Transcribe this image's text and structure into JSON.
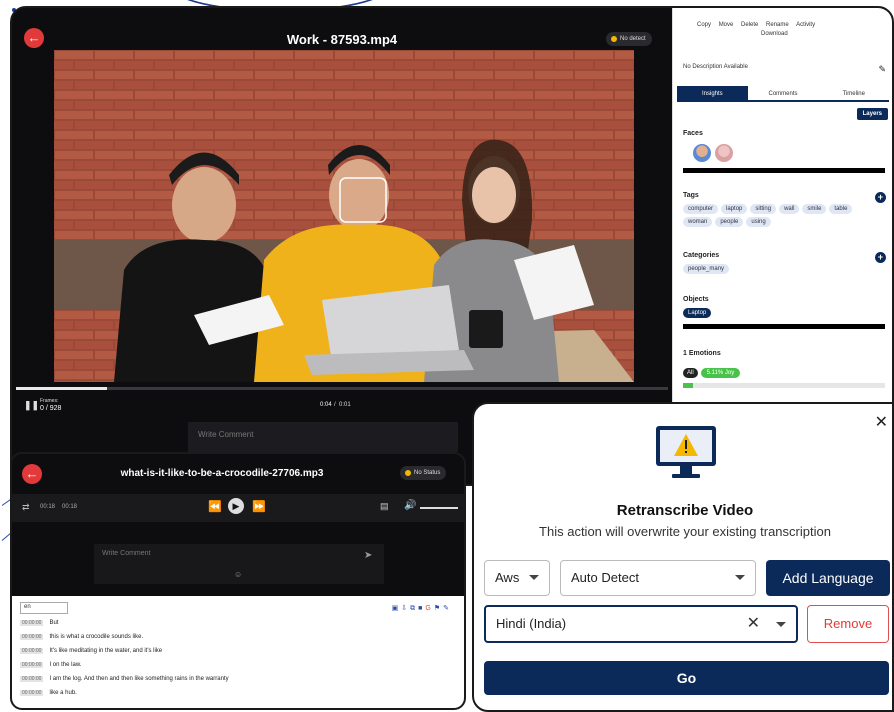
{
  "main_player": {
    "title": "Work - 87593.mp4",
    "status": "No detect",
    "frames_label": "Frames:",
    "frames_value": "0 / 928",
    "time_current": "0:04",
    "time_total": "0:01",
    "comment_placeholder": "Write Comment",
    "progress_fraction": 0.14
  },
  "side_panel": {
    "toolbar": [
      "Copy",
      "Move",
      "Delete",
      "Rename",
      "Activity",
      "Download"
    ],
    "description": "No Description Available",
    "tabs": [
      "Insights",
      "Comments",
      "Timeline"
    ],
    "active_tab": "Insights",
    "layers_label": "Layers",
    "faces_title": "Faces",
    "tags_title": "Tags",
    "tags": [
      "computer",
      "laptop",
      "sitting",
      "wall",
      "smile",
      "table",
      "woman",
      "people",
      "using"
    ],
    "categories_title": "Categories",
    "categories": [
      "people_many"
    ],
    "objects_title": "Objects",
    "objects": [
      "Laptop"
    ],
    "emotions_title": "1 Emotions",
    "emotion_all": "All",
    "emotion_joy": "5.11% Joy",
    "emotion_fraction": 0.0511
  },
  "second_player": {
    "title": "what-is-it-like-to-be-a-crocodile-27706.mp3",
    "status": "No Status",
    "time_current": "00:18",
    "time_total": "00:18",
    "comment_placeholder": "Write Comment",
    "language": "en",
    "transcript": [
      {
        "ts": "00:00:00",
        "text": "But"
      },
      {
        "ts": "00:00:00",
        "text": "this is what a crocodile sounds like."
      },
      {
        "ts": "00:00:00",
        "text": "It's like meditating in the water, and it's like"
      },
      {
        "ts": "00:00:00",
        "text": "I on the law."
      },
      {
        "ts": "00:00:00",
        "text": "I am the log. And then and then like something rains in the warranty"
      },
      {
        "ts": "00:00:00",
        "text": "like a hub."
      }
    ]
  },
  "modal": {
    "title": "Retranscribe Video",
    "subtitle": "This action will overwrite your existing transcription",
    "provider": "Aws",
    "detect": "Auto Detect",
    "add_language": "Add Language",
    "language_value": "Hindi (India)",
    "remove": "Remove",
    "go": "Go",
    "close_icon": "close-icon",
    "warning_icon": "warning-monitor-icon"
  },
  "colors": {
    "navy": "#0b2a5a",
    "red": "#e23a3a",
    "green": "#49c24a",
    "yellow": "#f5b800"
  }
}
